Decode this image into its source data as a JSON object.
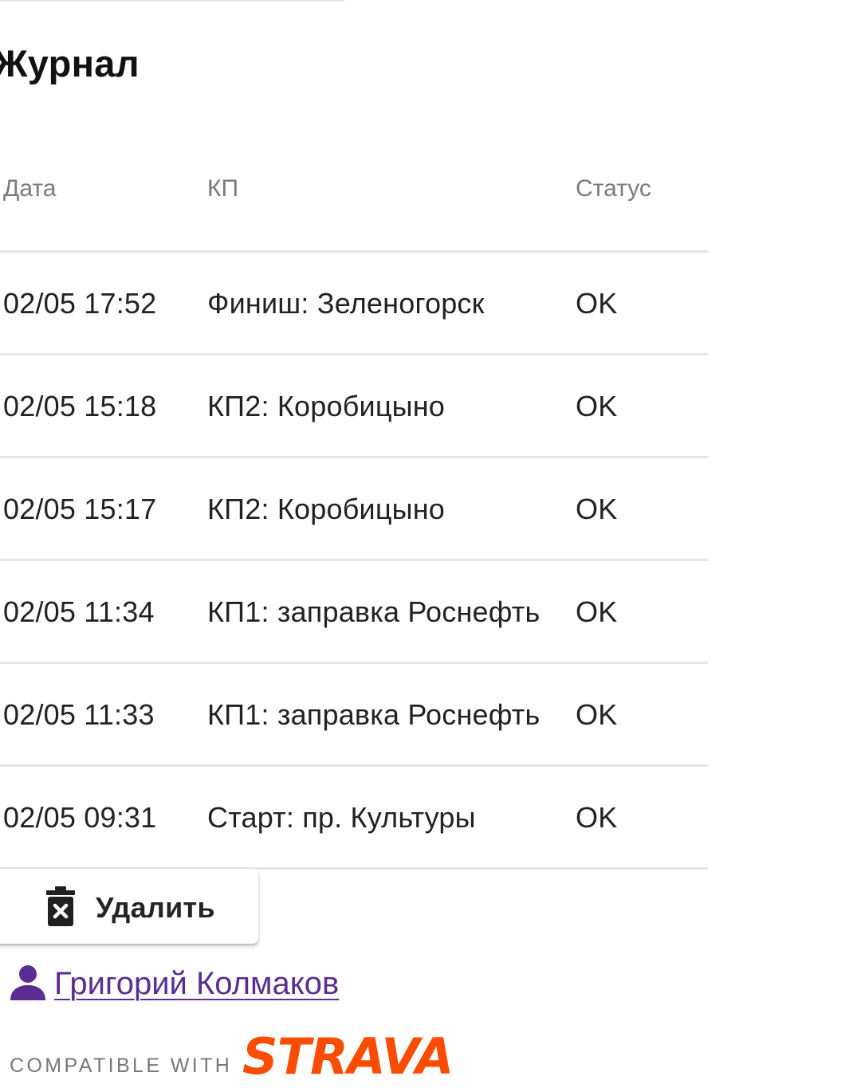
{
  "page": {
    "title": "Журнал"
  },
  "table": {
    "headers": {
      "date": "Дата",
      "cp": "КП",
      "status": "Статус"
    },
    "rows": [
      {
        "date": "02/05 17:52",
        "cp": "Финиш: Зеленогорск",
        "status": "OK"
      },
      {
        "date": "02/05 15:18",
        "cp": "КП2: Коробицыно",
        "status": "OK"
      },
      {
        "date": "02/05 15:17",
        "cp": "КП2: Коробицыно",
        "status": "OK"
      },
      {
        "date": "02/05 11:34",
        "cp": "КП1: заправка Роснефть",
        "status": "OK"
      },
      {
        "date": "02/05 11:33",
        "cp": "КП1: заправка Роснефть",
        "status": "OK"
      },
      {
        "date": "02/05 09:31",
        "cp": "Старт: пр. Культуры",
        "status": "OK"
      }
    ]
  },
  "actions": {
    "delete_label": "Удалить",
    "delete_icon": "trash-icon"
  },
  "user": {
    "name": "Григорий Колмаков",
    "icon": "person-icon",
    "link_color": "#5a2d91"
  },
  "footer": {
    "compatible_text": "COMPATIBLE WITH",
    "strava_logo_text": "STRAVA",
    "strava_color": "#fc4c02"
  }
}
